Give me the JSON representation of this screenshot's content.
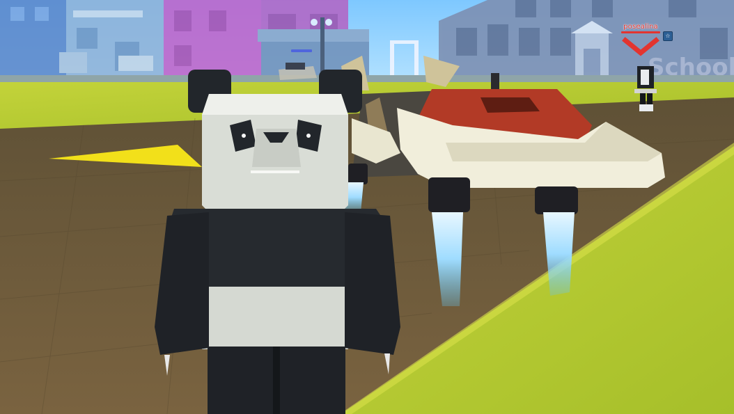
{
  "scene": {
    "building_sign": "School",
    "player_name": "posealina",
    "far_sign_text": "",
    "colors": {
      "sky": "#8fd3ff",
      "grass": "#b9cc2c",
      "road": "#6b5838",
      "panda_white": "#e8ebe6",
      "panda_black": "#22262b",
      "hover_red": "#b23a26",
      "hover_cream": "#f1eedb",
      "thruster_blue": "#a9e2ff",
      "nametag_red": "#e3342f"
    }
  },
  "hud": {
    "player_marker_icon": "chevron-down-icon",
    "player_badge_icon": "player-badge-icon",
    "player_badge_glyph": "☆"
  }
}
